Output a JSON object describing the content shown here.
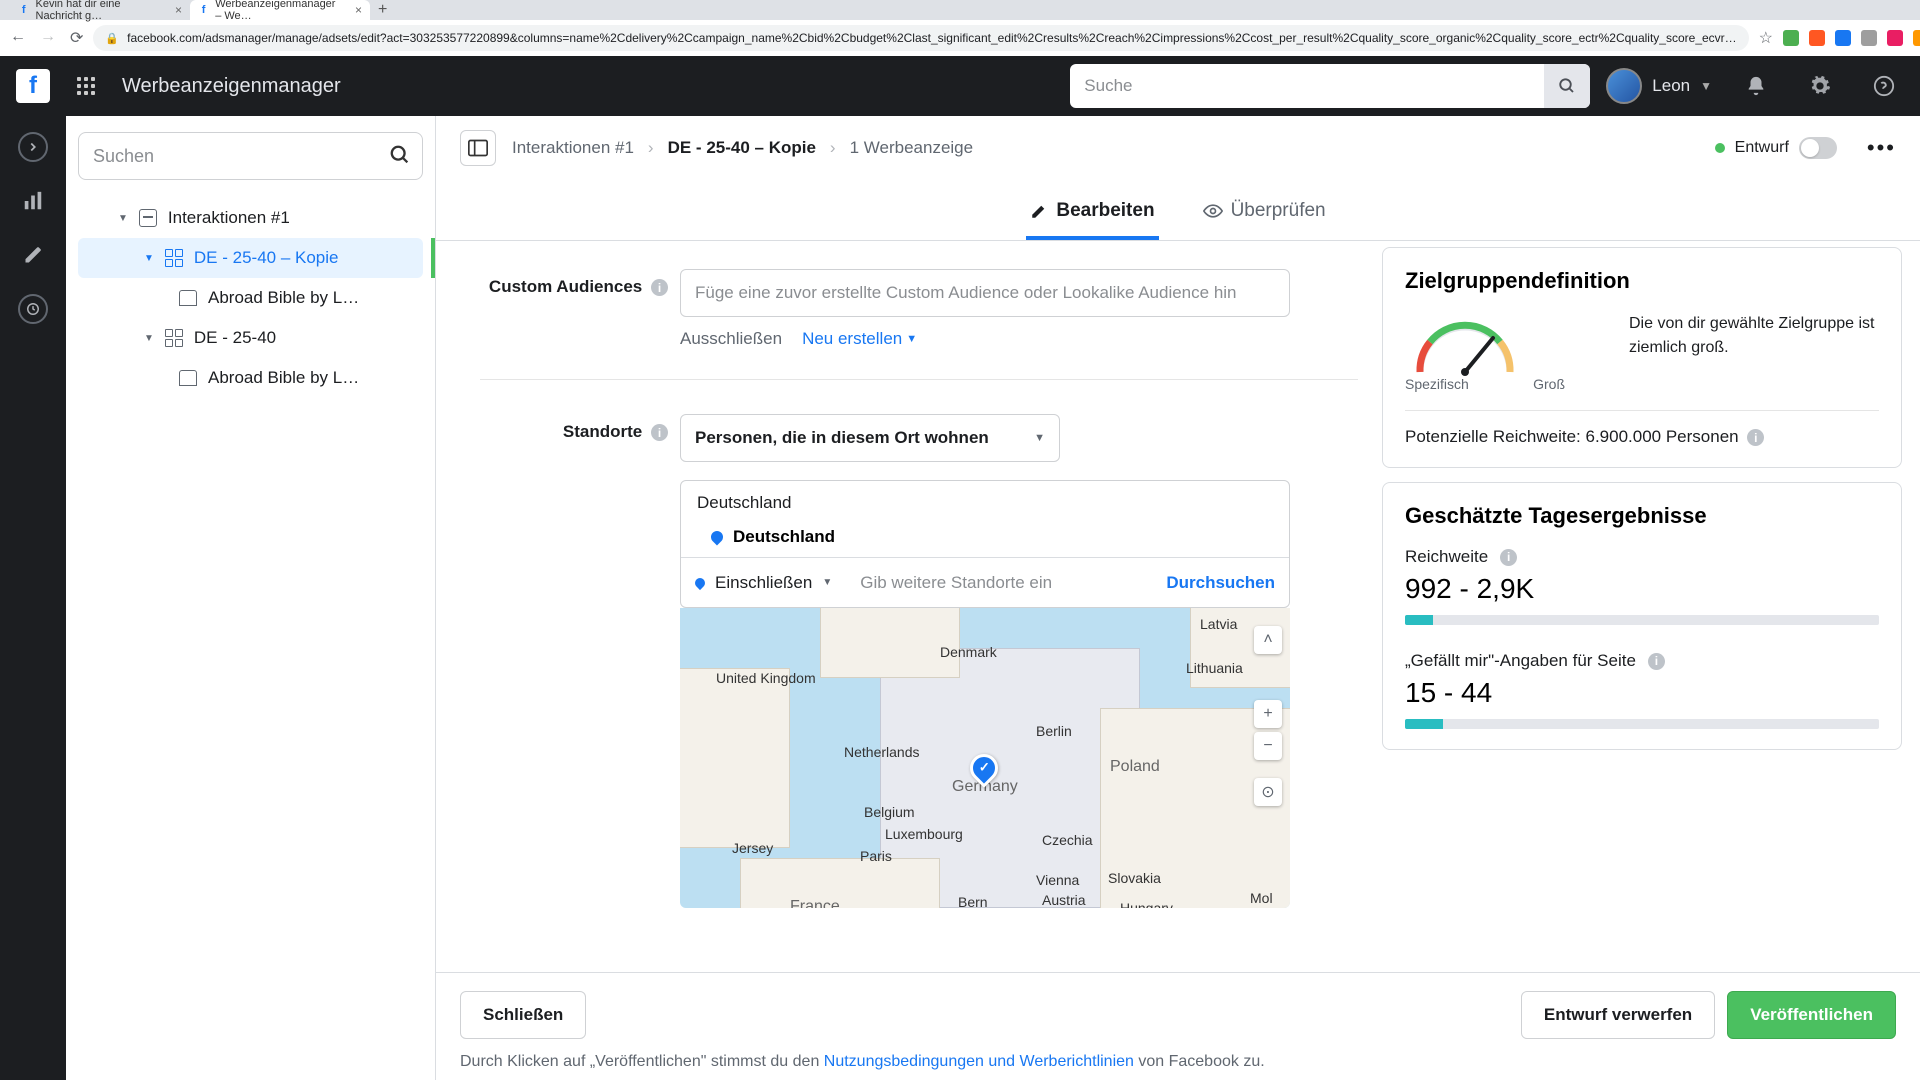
{
  "browser": {
    "tab1": "Kevin hat dir eine Nachricht g…",
    "tab2": "Werbeanzeigenmanager – We…",
    "url": "facebook.com/adsmanager/manage/adsets/edit?act=303253577220899&columns=name%2Cdelivery%2Ccampaign_name%2Cbid%2Cbudget%2Clast_significant_edit%2Cresults%2Creach%2Cimpressions%2Ccost_per_result%2Cquality_score_organic%2Cquality_score_ectr%2Cquality_score_ecvr…"
  },
  "top": {
    "title": "Werbeanzeigenmanager",
    "search_ph": "Suche",
    "user": "Leon"
  },
  "tree": {
    "search_ph": "Suchen",
    "root": "Interaktionen #1",
    "set1": "DE - 25-40 – Kopie",
    "ad1": "Abroad Bible by L…",
    "set2": "DE - 25-40",
    "ad2": "Abroad Bible by L…"
  },
  "crumbs": {
    "c1": "Interaktionen #1",
    "c2": "DE - 25-40 – Kopie",
    "c3": "1 Werbeanzeige",
    "draft": "Entwurf"
  },
  "tabs": {
    "edit": "Bearbeiten",
    "review": "Überprüfen"
  },
  "form": {
    "ca_label": "Custom Audiences",
    "ca_ph": "Füge eine zuvor erstellte Custom Audience oder Lookalike Audience hin",
    "exclude": "Ausschließen",
    "create_new": "Neu erstellen",
    "loc_label": "Standorte",
    "loc_select": "Personen, die in diesem Ort wohnen",
    "country_group": "Deutschland",
    "country": "Deutschland",
    "include": "Einschließen",
    "loc_ph": "Gib weitere Standorte ein",
    "browse": "Durchsuchen"
  },
  "map": {
    "uk": "United Kingdom",
    "dk": "Denmark",
    "lv": "Latvia",
    "lt": "Lithuania",
    "nl": "Netherlands",
    "be": "Belgium",
    "lu": "Luxembourg",
    "de": "Germany",
    "pl": "Poland",
    "cz": "Czechia",
    "sk": "Slovakia",
    "at": "Austria",
    "hu": "Hungary",
    "fr": "France",
    "paris": "Paris",
    "berlin": "Berlin",
    "bern": "Bern",
    "vienna": "Vienna",
    "jersey": "Jersey",
    "mol": "Mol"
  },
  "audience": {
    "title": "Zielgruppendefinition",
    "spec": "Spezifisch",
    "broad": "Groß",
    "text": "Die von dir gewählte Zielgruppe ist ziemlich groß.",
    "reach": "Potenzielle Reichweite: 6.900.000 Personen"
  },
  "daily": {
    "title": "Geschätzte Tagesergebnisse",
    "reach_label": "Reichweite",
    "reach_value": "992 - 2,9K",
    "likes_label": "„Gefällt mir\"-Angaben für Seite",
    "likes_value": "15 - 44"
  },
  "footer": {
    "close": "Schließen",
    "discard": "Entwurf verwerfen",
    "publish": "Veröffentlichen",
    "note1": "Durch Klicken auf „Veröffentlichen\" stimmst du den ",
    "link": "Nutzungsbedingungen und Werberichtlinien",
    "note2": " von Facebook zu."
  }
}
